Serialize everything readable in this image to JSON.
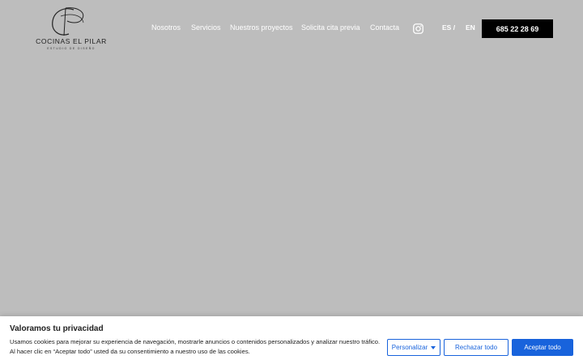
{
  "brand": {
    "monogram": "CP",
    "name": "COCINAS EL PILAR",
    "tagline": "ESTUDIO DE DISEÑO"
  },
  "nav": {
    "items": [
      "Nosotros",
      "Servicios",
      "Nuestros proyectos",
      "Solicita cita previa",
      "Contacta"
    ]
  },
  "social": {
    "icon": "instagram-icon"
  },
  "language": {
    "es": "ES /",
    "en": "EN"
  },
  "phone": {
    "label": "685 22 28 69"
  },
  "cookie_banner": {
    "title": "Valoramos tu privacidad",
    "text": "Usamos cookies para mejorar su experiencia de navegación, mostrarle anuncios o contenidos personalizados y analizar nuestro tráfico. Al hacer clic en “Aceptar todo” usted da su consentimiento a nuestro uso de las cookies.",
    "customize_label": "Personalizar",
    "reject_label": "Rechazar todo",
    "accept_label": "Aceptar todo"
  },
  "colors": {
    "hero_background": "#bdbdbd",
    "phone_button": "#000000",
    "cookie_accent": "#1863dc"
  }
}
